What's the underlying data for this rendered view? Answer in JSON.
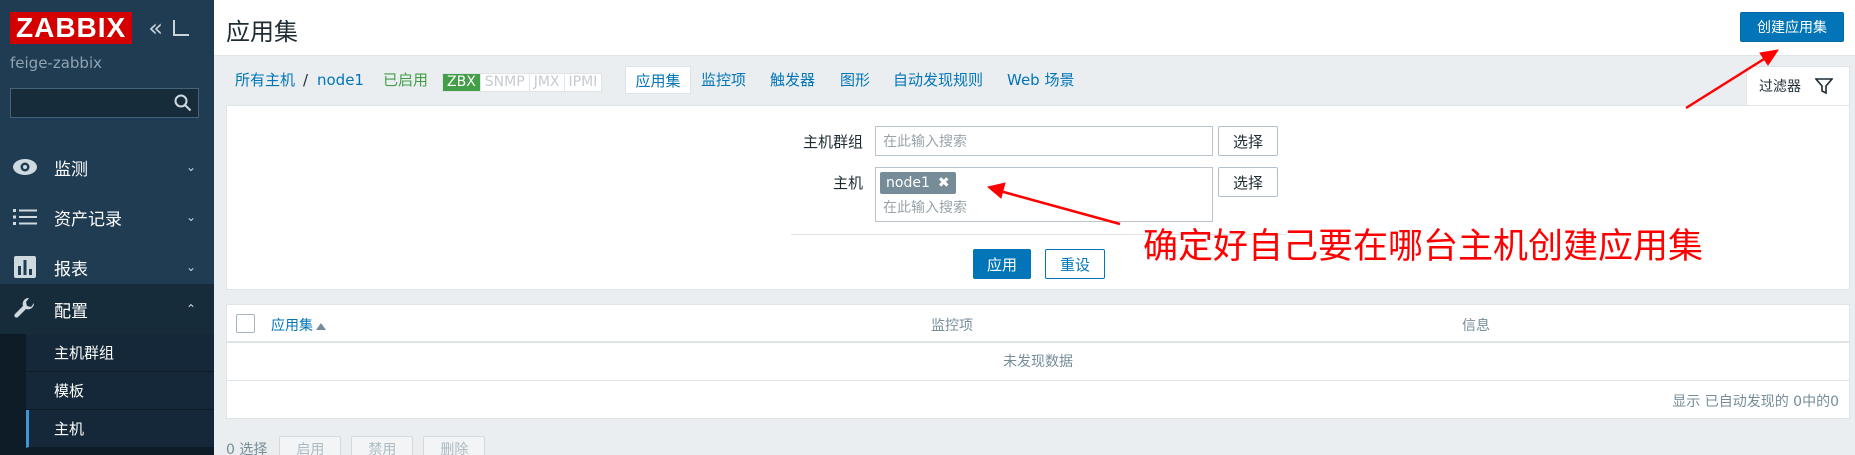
{
  "sidebar": {
    "logo": "ZABBIX",
    "server_name": "feige-zabbix",
    "search_placeholder": "",
    "menu": [
      {
        "label": "监测",
        "icon": "eye-icon"
      },
      {
        "label": "资产记录",
        "icon": "list-icon"
      },
      {
        "label": "报表",
        "icon": "bar-chart-icon"
      },
      {
        "label": "配置",
        "icon": "wrench-icon"
      }
    ],
    "submenu": [
      {
        "label": "主机群组"
      },
      {
        "label": "模板"
      },
      {
        "label": "主机"
      }
    ]
  },
  "header": {
    "title": "应用集",
    "create_button": "创建应用集"
  },
  "nav": {
    "all_hosts": "所有主机",
    "separator": "/",
    "host": "node1",
    "status": "已启用",
    "badges": [
      "ZBX",
      "SNMP",
      "JMX",
      "IPMI"
    ],
    "tabs": [
      "应用集",
      "监控项",
      "触发器",
      "图形",
      "自动发现规则",
      "Web 场景"
    ],
    "filter_tab": "过滤器"
  },
  "filter": {
    "host_group_label": "主机群组",
    "host_group_placeholder": "在此输入搜索",
    "host_label": "主机",
    "host_tag": "node1",
    "host_placeholder": "在此输入搜索",
    "select_button": "选择",
    "apply_button": "应用",
    "reset_button": "重设"
  },
  "annotation": {
    "text": "确定好自己要在哪台主机创建应用集",
    "color": "#ff0000"
  },
  "table": {
    "columns": [
      "应用集",
      "监控项",
      "信息"
    ],
    "no_data": "未发现数据",
    "paging": "显示 已自动发现的 0中的0"
  },
  "footer": {
    "selected": "0 选择",
    "buttons": [
      "启用",
      "禁用",
      "删除"
    ]
  },
  "colors": {
    "accent": "#0275b8",
    "sidebar": "#1f3c52",
    "logo": "#d40000",
    "enabled": "#429e47"
  }
}
